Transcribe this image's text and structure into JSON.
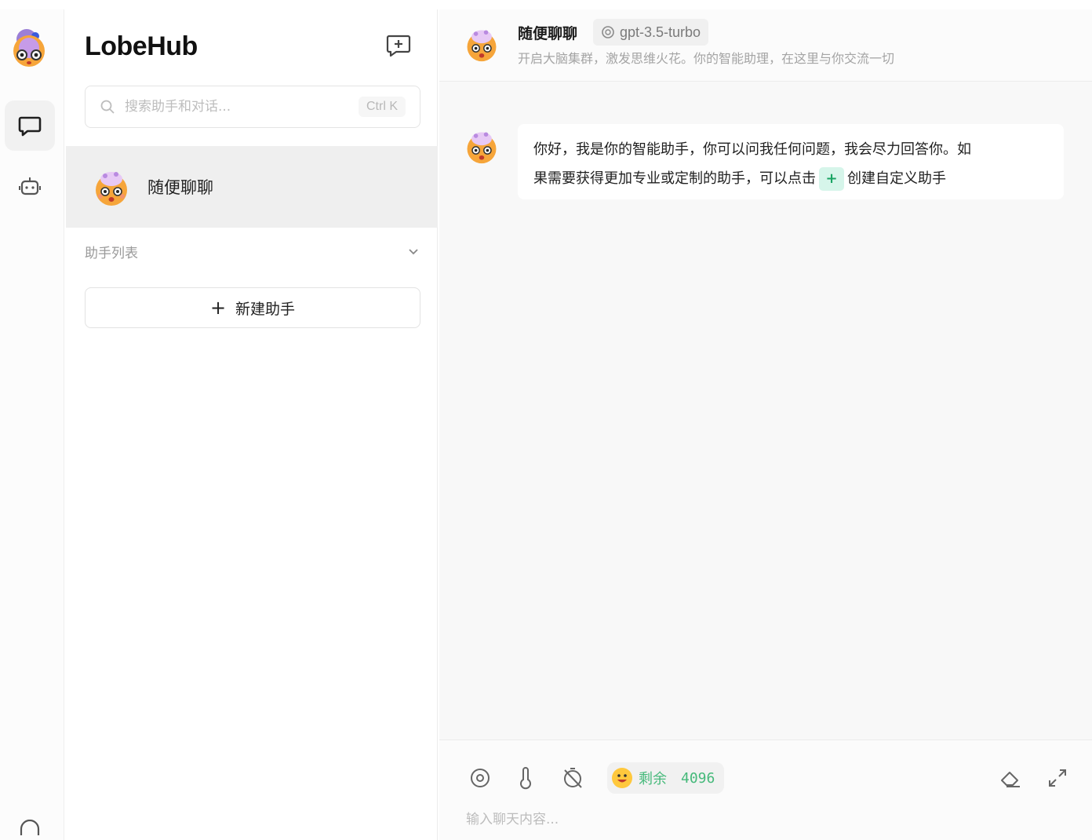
{
  "brand": {
    "name": "LobeHub"
  },
  "colors": {
    "accent_green": "#45b97a",
    "selected_bg": "#efefef"
  },
  "rail": {
    "items": [
      {
        "name": "chat",
        "icon": "chat-bubble-icon",
        "active": true
      },
      {
        "name": "agents",
        "icon": "robot-icon",
        "active": false
      }
    ]
  },
  "sidebar": {
    "search_placeholder": "搜索助手和对话...",
    "shortcut": "Ctrl K",
    "sessions": [
      {
        "title": "随便聊聊",
        "avatar": "exploding-head-emoji"
      }
    ],
    "group_label": "助手列表",
    "add_agent": {
      "plus": "+",
      "label": "新建助手"
    }
  },
  "chat": {
    "header": {
      "title": "随便聊聊",
      "model": "gpt-3.5-turbo",
      "description": "开启大脑集群，激发思维火花。你的智能助理，在这里与你交流一切"
    },
    "message": {
      "line1": "你好，我是你的智能助手，你可以问我任何问题，我会尽力回答你。如",
      "line2_before": "果需要获得更加专业或定制的助手，可以点击",
      "plus": "+",
      "line2_after": "创建自定义助手"
    },
    "input": {
      "token_label": "剩余",
      "token_count": "4096",
      "placeholder": "输入聊天内容..."
    }
  }
}
